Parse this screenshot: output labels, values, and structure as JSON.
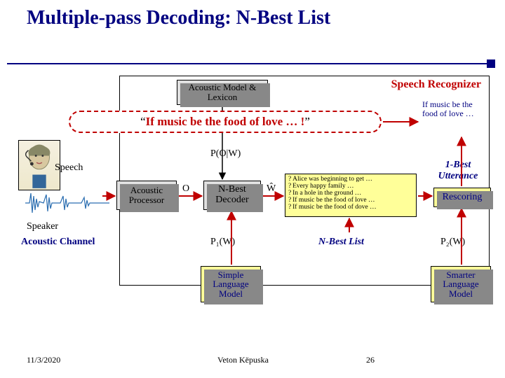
{
  "title": "Multiple-pass Decoding: N-Best List",
  "recognizer_label": "Speech Recognizer",
  "am_box": "Acoustic Model & Lexicon",
  "speech_text": "If music be the food of love … !",
  "if_music_right": "If music be the food of love …",
  "pow": "P(O|W)",
  "speech_label": "Speech",
  "speaker_label": "Speaker",
  "ac_channel": "Acoustic Channel",
  "ap_box": "Acoustic Processor",
  "nb_box": "N-Best Decoder",
  "o_label": "O",
  "w_label": "Ŵ",
  "hyp": [
    "Alice was beginning to get …",
    "Every happy family …",
    "In a hole in the ground …",
    "If music be the food of love …",
    "If music be the food of dove …"
  ],
  "rescoring": "Rescoring",
  "best_utt": "1-Best Utterance",
  "p1w": "P₁(W)",
  "p2w": "P₂(W)",
  "nbest_list_label": "N-Best List",
  "slm": "Simple Language Model",
  "smlm": "Smarter Language Model",
  "footer": {
    "date": "11/3/2020",
    "author": "Veton Këpuska",
    "page": "26"
  }
}
